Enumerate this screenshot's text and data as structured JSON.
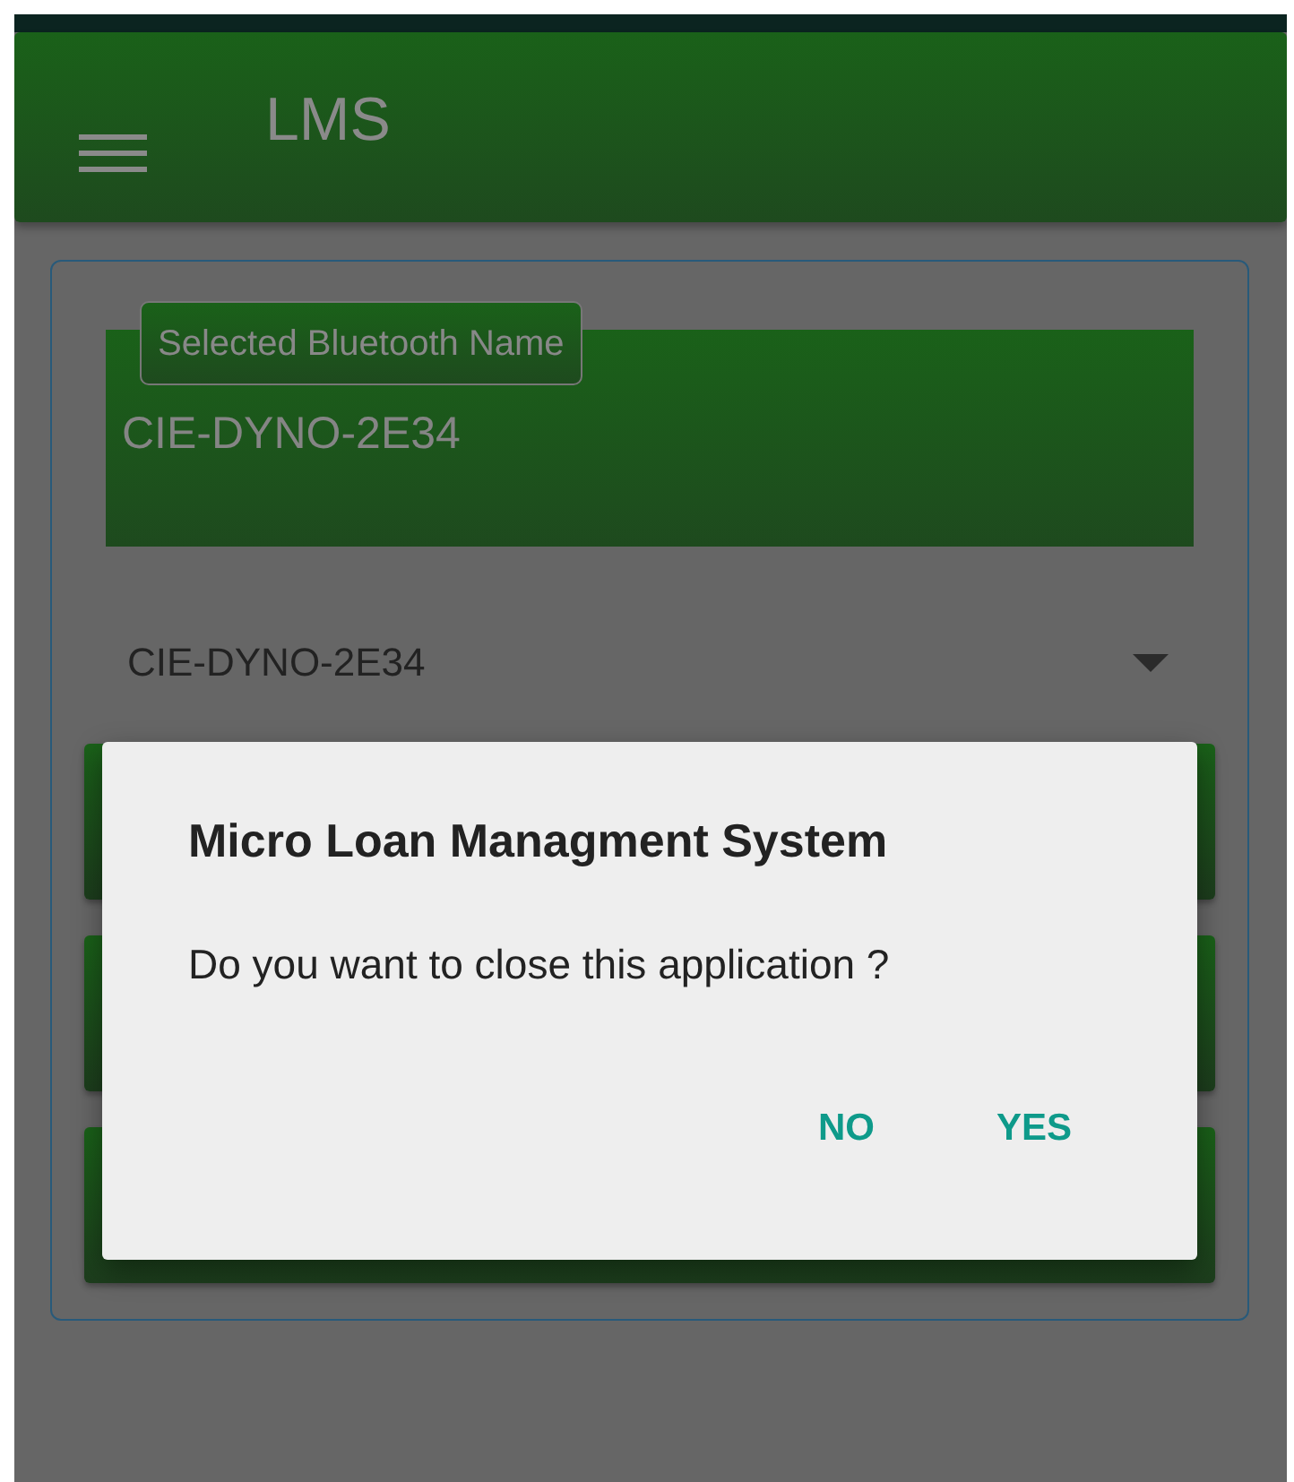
{
  "app_bar": {
    "title": "LMS"
  },
  "bluetooth_field": {
    "label": "Selected Bluetooth Name",
    "value": "CIE-DYNO-2E34"
  },
  "device_dropdown": {
    "value": "CIE-DYNO-2E34"
  },
  "dialog": {
    "title": "Micro Loan Managment System",
    "message": "Do you want to close this application ?",
    "buttons": [
      "NO",
      "YES"
    ]
  }
}
